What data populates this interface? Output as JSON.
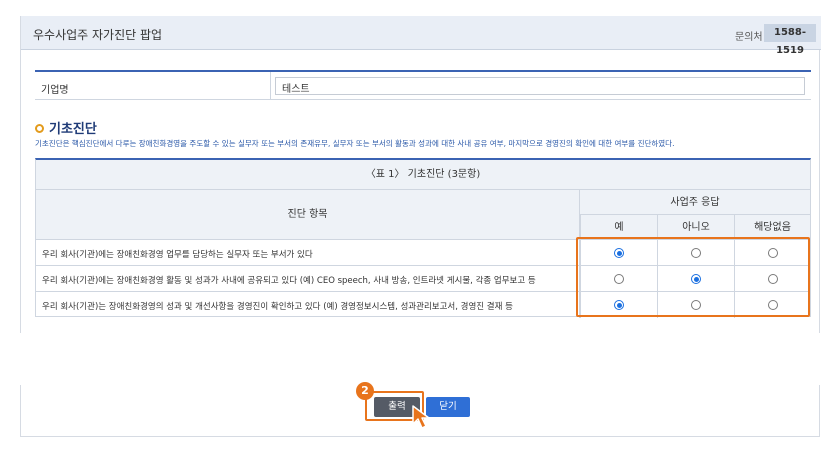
{
  "header": {
    "title": "우수사업주 자가진단 팝업",
    "contact_label": "문의처",
    "contact_phone": "1588-1519"
  },
  "company": {
    "label": "기업명",
    "value": "테스트"
  },
  "section": {
    "title": "기초진단",
    "description": "기초진단은 핵심진단에서 다루는 장애친화경영을 주도할 수 있는 실무자 또는 부서의 존재유무, 실무자 또는 부서의 활동과 성과에 대한 사내 공유 여부, 마지막으로 경영진의 확인에 대한 여부를 진단하였다."
  },
  "table": {
    "caption": "〈표 1〉 기초진단 (3문항)",
    "item_header": "진단 항목",
    "response_header": "사업주 응답",
    "options": [
      "예",
      "아니오",
      "해당없음"
    ],
    "rows": [
      {
        "question": "우리 회사(기관)에는 장애친화경영 업무를 담당하는 실무자 또는 부서가 있다",
        "selected": 0
      },
      {
        "question": "우리 회사(기관)에는 장애친화경영 활동 및 성과가 사내에 공유되고 있다 (예) CEO speech, 사내 방송, 인트라넷 게시물, 각종 업무보고 등",
        "selected": 1
      },
      {
        "question": "우리 회사(기관)는 장애친화경영의 성과 및 개선사항을 경영진이 확인하고 있다 (예) 경영정보시스템, 성과관리보고서, 경영진 결재 등",
        "selected": 0
      }
    ]
  },
  "buttons": {
    "print_label": "출력",
    "close_label": "닫기"
  },
  "annotation": {
    "step_number": "2"
  },
  "colors": {
    "accent_blue": "#3b63b3",
    "highlight_orange": "#e8741c",
    "radio_blue": "#1a6fe0"
  }
}
